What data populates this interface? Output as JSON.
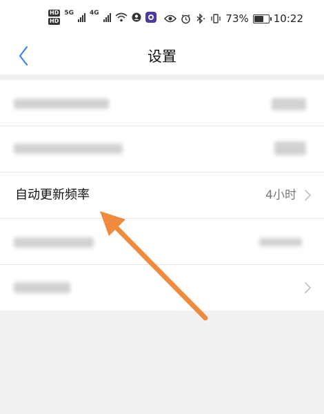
{
  "status_bar": {
    "hd1": "HD",
    "hd2": "HD",
    "net1": "5G",
    "net2": "4G",
    "battery_percent": "73%",
    "battery_level": 0.73,
    "time": "10:22"
  },
  "header": {
    "title": "设置",
    "back_icon": "chevron-left-icon"
  },
  "settings": {
    "auto_update_label": "自动更新频率",
    "auto_update_value": "4小时"
  },
  "colors": {
    "accent": "#3b82f6",
    "annotation_arrow": "#f08a3c",
    "background": "#f1f1f2"
  }
}
